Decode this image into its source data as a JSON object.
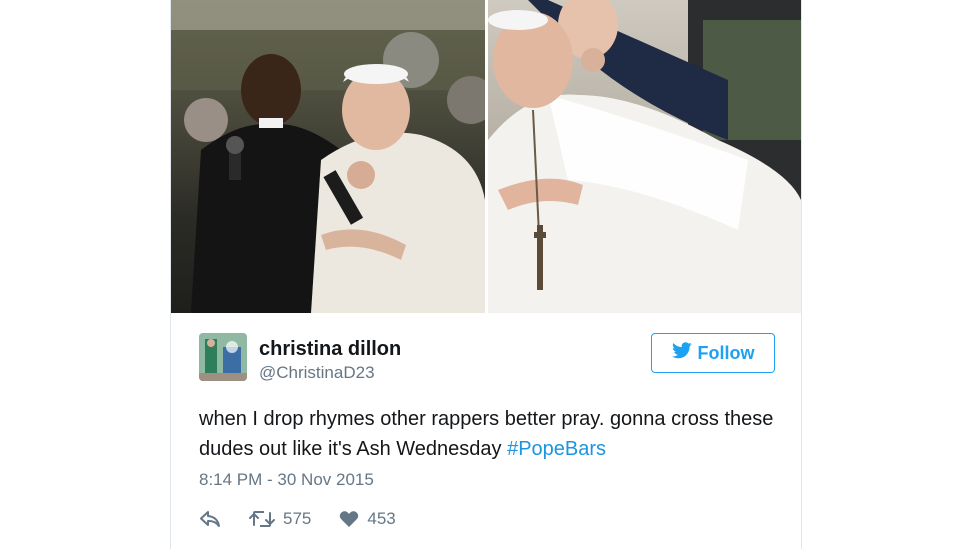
{
  "tweet": {
    "user": {
      "display_name": "christina dillon",
      "handle": "@ChristinaD23"
    },
    "follow_label": "Follow",
    "text_main": "when I drop rhymes other rappers better pray. gonna cross these dudes out like it's Ash Wednesday ",
    "hashtag": "#PopeBars",
    "timestamp": "8:14 PM - 30 Nov 2015",
    "retweet_count": "575",
    "like_count": "453"
  },
  "icons": {
    "follow": "twitter-bird-icon",
    "reply": "reply-icon",
    "retweet": "retweet-icon",
    "like": "heart-icon"
  },
  "colors": {
    "accent": "#1da1f2",
    "hashtag": "#1b95e0",
    "text": "#14171a",
    "muted": "#657786"
  }
}
